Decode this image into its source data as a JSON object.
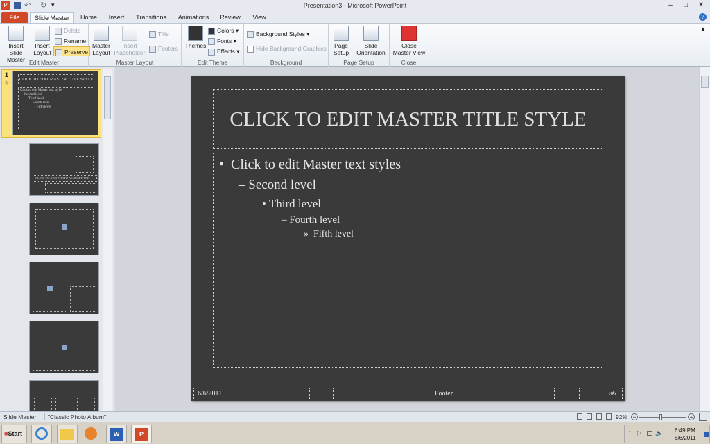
{
  "window": {
    "title": "Presentation3 - Microsoft PowerPoint",
    "minimize": "–",
    "maximize": "□",
    "close": "✕"
  },
  "qat": {
    "app_icon": "P",
    "save_icon": "save-icon",
    "undo_icon": "↶",
    "redo_icon": "↻",
    "customize": "▾"
  },
  "tabs": [
    "File",
    "Slide Master",
    "Home",
    "Insert",
    "Transitions",
    "Animations",
    "Review",
    "View"
  ],
  "ribbon": {
    "edit_master": {
      "label": "Edit Master",
      "insert_slide_master": "Insert Slide Master",
      "insert_layout": "Insert Layout",
      "delete": "Delete",
      "rename": "Rename",
      "preserve": "Preserve"
    },
    "master_layout": {
      "label": "Master Layout",
      "master_layout": "Master Layout",
      "insert_placeholder": "Insert Placeholder",
      "title": "Title",
      "footers": "Footers"
    },
    "edit_theme": {
      "label": "Edit Theme",
      "themes": "Themes",
      "colors": "Colors",
      "fonts": "Fonts",
      "effects": "Effects"
    },
    "background": {
      "label": "Background",
      "background_styles": "Background Styles",
      "hide_background_graphics": "Hide Background Graphics"
    },
    "page_setup": {
      "label": "Page Setup",
      "page_setup": "Page Setup",
      "slide_orientation": "Slide Orientation"
    },
    "close": {
      "label": "Close",
      "close_master_view": "Close Master View"
    }
  },
  "thumbnails": {
    "master_number": "1",
    "master_title": "CLICK TO EDIT MASTER TITLE STYLE",
    "master_body": [
      "Click to edit Master text styles",
      "Second level",
      "Third level",
      "Fourth level",
      "Fifth level"
    ],
    "layout_title": "CLICK TO ADD PHOTO ALBUM TITLE"
  },
  "slide": {
    "title": "CLICK TO EDIT MASTER TITLE STYLE",
    "levels": [
      {
        "bullet": "•",
        "text": "Click to edit Master text styles"
      },
      {
        "bullet": "–",
        "text": "Second level"
      },
      {
        "bullet": "•",
        "text": "Third level"
      },
      {
        "bullet": "–",
        "text": "Fourth level"
      },
      {
        "bullet": "»",
        "text": "Fifth level"
      }
    ],
    "date": "6/6/2011",
    "footer": "Footer",
    "number": "‹#›"
  },
  "status": {
    "view": "Slide Master",
    "theme": "\"Classic Photo Album\"",
    "zoom": "92%"
  },
  "taskbar": {
    "start": "Start",
    "time": "6:49 PM",
    "date": "6/6/2011"
  }
}
